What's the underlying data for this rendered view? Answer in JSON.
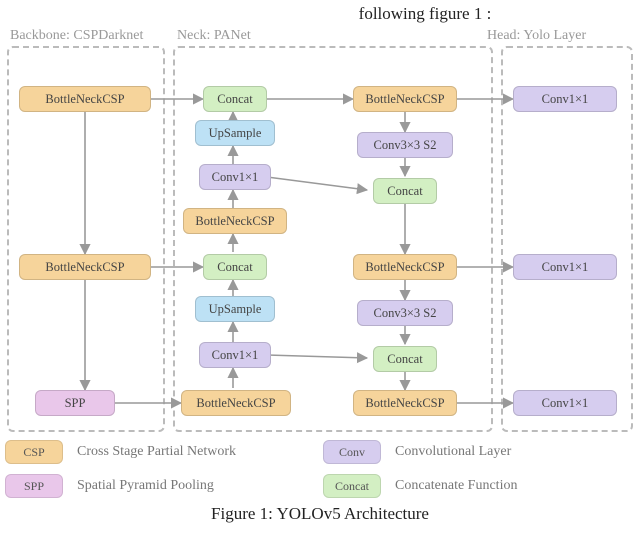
{
  "intro": "following figure 1 :",
  "sections": {
    "backbone": "Backbone: CSPDarknet",
    "neck": "Neck: PANet",
    "head": "Head: Yolo Layer"
  },
  "blocks": {
    "bb_csp1": "BottleNeckCSP",
    "bb_csp2": "BottleNeckCSP",
    "bb_spp": "SPP",
    "nk_concat1": "Concat",
    "nk_up1": "UpSample",
    "nk_conv1": "Conv1×1",
    "nk_csp1": "BottleNeckCSP",
    "nk_concat2": "Concat",
    "nk_up2": "UpSample",
    "nk_conv2": "Conv1×1",
    "nk_csp2": "BottleNeckCSP",
    "nk_csp3": "BottleNeckCSP",
    "nk_conv3": "Conv3×3 S2",
    "nk_concat3": "Concat",
    "nk_csp4": "BottleNeckCSP",
    "nk_conv4": "Conv3×3 S2",
    "nk_concat4": "Concat",
    "nk_csp5": "BottleNeckCSP",
    "hd_conv1": "Conv1×1",
    "hd_conv2": "Conv1×1",
    "hd_conv3": "Conv1×1"
  },
  "legend": {
    "csp": {
      "abbr": "CSP",
      "desc": "Cross Stage Partial Network"
    },
    "conv": {
      "abbr": "Conv",
      "desc": "Convolutional Layer"
    },
    "spp": {
      "abbr": "SPP",
      "desc": "Spatial Pyramid Pooling"
    },
    "concat": {
      "abbr": "Concat",
      "desc": "Concatenate Function"
    }
  },
  "caption": "Figure 1: YOLOv5 Architecture",
  "colors": {
    "csp": "#f6d49b",
    "conv": "#d6cdef",
    "concat": "#d3efc3",
    "spp": "#e9c7ea",
    "up": "#bde1f5"
  }
}
